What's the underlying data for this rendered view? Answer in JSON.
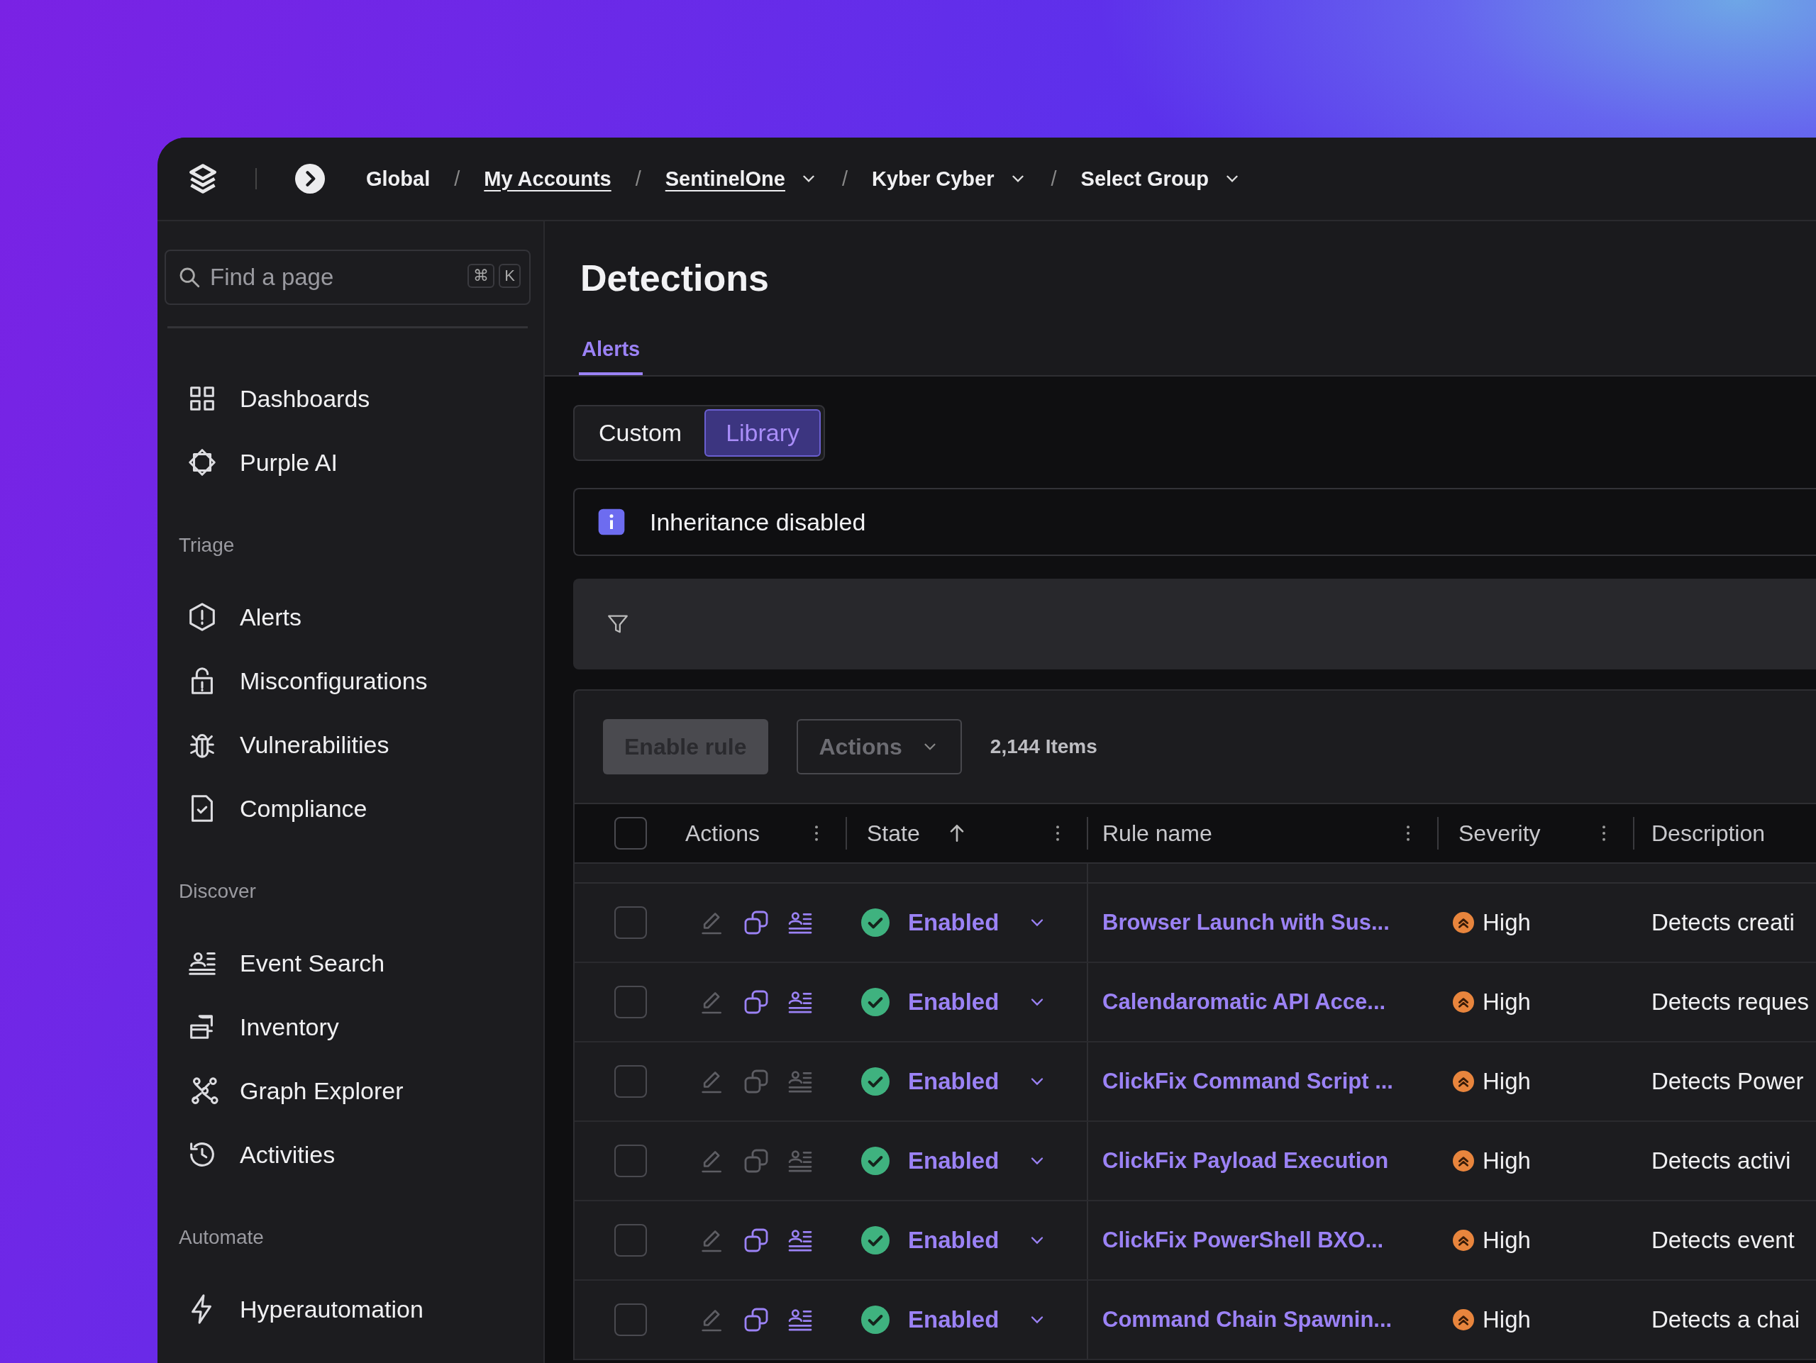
{
  "breadcrumbs": [
    {
      "label": "Global",
      "link": false,
      "dropdown": false
    },
    {
      "label": "My Accounts",
      "link": true,
      "dropdown": false
    },
    {
      "label": "SentinelOne",
      "link": true,
      "dropdown": true
    },
    {
      "label": "Kyber Cyber",
      "link": false,
      "dropdown": true
    },
    {
      "label": "Select Group",
      "link": false,
      "dropdown": true
    }
  ],
  "breadcrumb_separator": "/",
  "sidebar": {
    "search": {
      "placeholder": "Find a page",
      "shortcut": [
        "⌘",
        "K"
      ]
    },
    "sections": [
      {
        "items": [
          {
            "label": "Dashboards"
          },
          {
            "label": "Purple AI"
          }
        ]
      },
      {
        "heading": "Triage",
        "items": [
          {
            "label": "Alerts"
          },
          {
            "label": "Misconfigurations"
          },
          {
            "label": "Vulnerabilities"
          },
          {
            "label": "Compliance"
          }
        ]
      },
      {
        "heading": "Discover",
        "items": [
          {
            "label": "Event Search"
          },
          {
            "label": "Inventory"
          },
          {
            "label": "Graph Explorer"
          },
          {
            "label": "Activities"
          }
        ]
      },
      {
        "heading": "Automate",
        "items": [
          {
            "label": "Hyperautomation"
          }
        ]
      }
    ]
  },
  "page": {
    "title": "Detections",
    "tabs": [
      {
        "label": "Alerts",
        "selected": true
      }
    ],
    "segments": [
      {
        "label": "Custom",
        "selected": false
      },
      {
        "label": "Library",
        "selected": true
      }
    ],
    "notice": "Inheritance disabled",
    "toolbar": {
      "enable_button": {
        "label": "Enable rule",
        "disabled": true
      },
      "actions_dropdown": "Actions",
      "count": "2,144 Items"
    },
    "table": {
      "all_selected": false,
      "columns": [
        {
          "label": "Actions",
          "sorted": false
        },
        {
          "label": "State",
          "sorted": true
        },
        {
          "label": "Rule name",
          "sorted": false
        },
        {
          "label": "Severity",
          "sorted": false
        },
        {
          "label": "Description",
          "sorted": false
        }
      ],
      "rows": [
        {
          "selected": false,
          "actions_enabled": true,
          "state": "Enabled",
          "rule": "Browser Launch with Sus...",
          "severity": "High",
          "description": "Detects creati"
        },
        {
          "selected": false,
          "actions_enabled": true,
          "state": "Enabled",
          "rule": "Calendaromatic API Acce...",
          "severity": "High",
          "description": "Detects reques"
        },
        {
          "selected": false,
          "actions_enabled": false,
          "state": "Enabled",
          "rule": "ClickFix Command Script ...",
          "severity": "High",
          "description": "Detects Power"
        },
        {
          "selected": false,
          "actions_enabled": false,
          "state": "Enabled",
          "rule": "ClickFix Payload Execution",
          "severity": "High",
          "description": "Detects activi"
        },
        {
          "selected": false,
          "actions_enabled": true,
          "state": "Enabled",
          "rule": "ClickFix PowerShell BXO...",
          "severity": "High",
          "description": "Detects event"
        },
        {
          "selected": false,
          "actions_enabled": true,
          "state": "Enabled",
          "rule": "Command Chain Spawnin...",
          "severity": "High",
          "description": "Detects a chai"
        }
      ]
    }
  }
}
